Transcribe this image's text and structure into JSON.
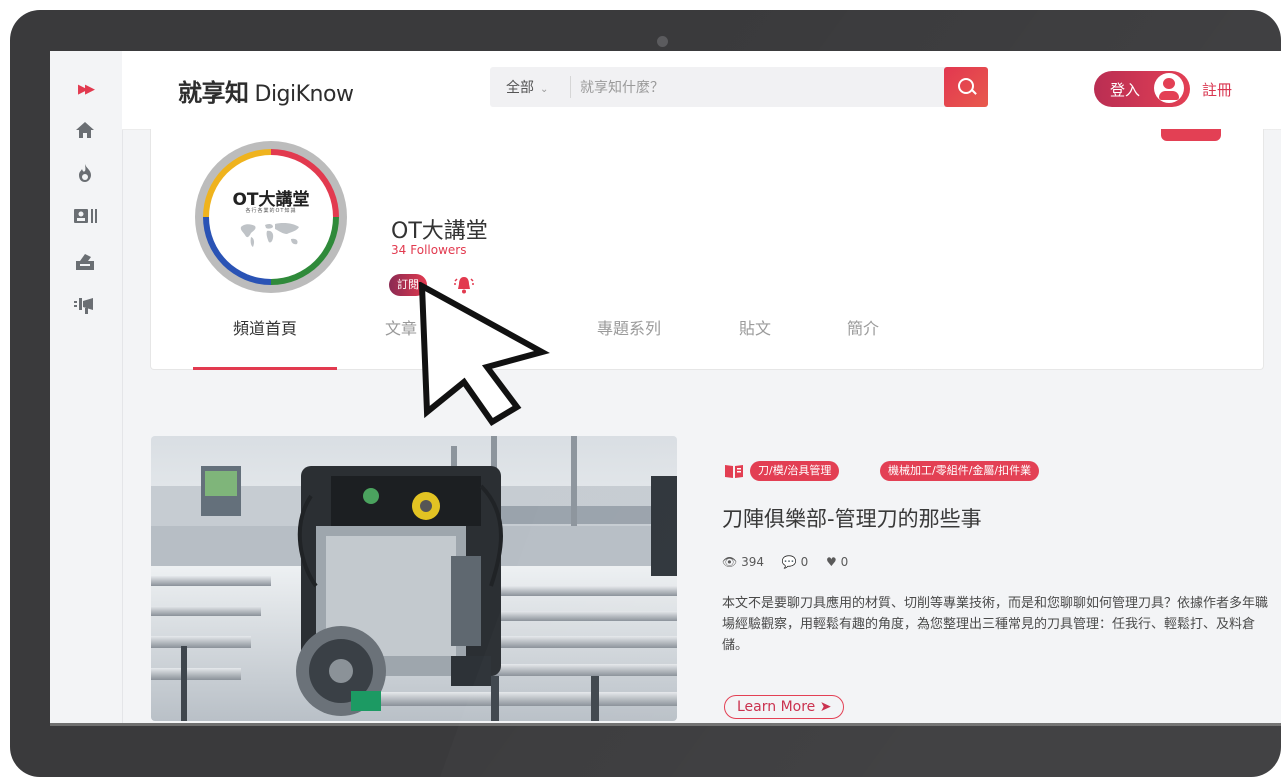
{
  "brand": {
    "logo_cn": "就享知",
    "logo_en": "DigiKnow"
  },
  "search": {
    "category": "全部",
    "placeholder": "就享知什麼？"
  },
  "auth": {
    "login_label": "登入",
    "register_label": "註冊"
  },
  "sidebar": {
    "items": [
      {
        "icon": "expand-icon"
      },
      {
        "icon": "home-icon"
      },
      {
        "icon": "fire-icon"
      },
      {
        "icon": "channel-list-icon"
      },
      {
        "icon": "inbox-icon"
      },
      {
        "icon": "announcement-icon"
      }
    ]
  },
  "channel": {
    "badge_title": "OT大講堂",
    "badge_subtitle": "各行各業的OT知識",
    "name": "OT大講堂",
    "followers_count": "34",
    "followers_label": "Followers",
    "subscribe_label": "訂閱"
  },
  "tabs": [
    {
      "label": "頻道首頁",
      "active": true
    },
    {
      "label": "文章",
      "active": false
    },
    {
      "label": "",
      "active": false
    },
    {
      "label": "專題系列",
      "active": false
    },
    {
      "label": "貼文",
      "active": false
    },
    {
      "label": "簡介",
      "active": false
    }
  ],
  "article": {
    "tags": [
      "刀/模/治具管理",
      "機械加工/零組件/金屬/扣件業"
    ],
    "title": "刀陣俱樂部-管理刀的那些事",
    "views": "394",
    "comments": "0",
    "likes": "0",
    "description": "本文不是要聊刀具應用的材質、切削等專業技術，而是和您聊聊如何管理刀具？依據作者多年職場經驗觀察，用輕鬆有趣的角度，為您整理出三種常見的刀具管理：任我行、輕鬆打、及料倉儲。",
    "cta_label": "Learn More ➤"
  },
  "colors": {
    "accent": "#e23a4f",
    "accent_dark": "#8a2a52",
    "frame": "#3a3a3c",
    "page_bg": "#f3f4f6"
  }
}
